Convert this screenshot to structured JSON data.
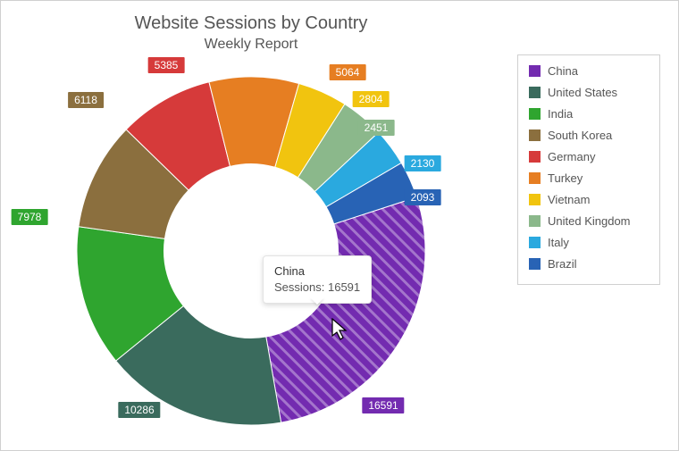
{
  "title": "Website Sessions by Country",
  "subtitle": "Weekly Report",
  "tooltip": {
    "title": "China",
    "metric_label": "Sessions",
    "value": "16591"
  },
  "legend": [
    {
      "label": "China",
      "color": "#732bb0"
    },
    {
      "label": "United States",
      "color": "#3a6b5d"
    },
    {
      "label": "India",
      "color": "#2fa52f"
    },
    {
      "label": "South Korea",
      "color": "#8b6f3e"
    },
    {
      "label": "Germany",
      "color": "#d63a3a"
    },
    {
      "label": "Turkey",
      "color": "#e67e22"
    },
    {
      "label": "Vietnam",
      "color": "#f1c40f"
    },
    {
      "label": "United Kingdom",
      "color": "#8bb88b"
    },
    {
      "label": "Italy",
      "color": "#2aa9df"
    },
    {
      "label": "Brazil",
      "color": "#2863b5"
    }
  ],
  "labels": {
    "china": "16591",
    "us": "10286",
    "india": "7978",
    "skorea": "6118",
    "germany": "5385",
    "turkey": "5064",
    "vietnam": "2804",
    "uk": "2451",
    "italy": "2130",
    "brazil": "2093"
  },
  "chart_data": {
    "type": "pie",
    "title": "Website Sessions by Country",
    "subtitle": "Weekly Report",
    "value_label": "Sessions",
    "series": [
      {
        "name": "China",
        "value": 16591,
        "color": "#732bb0",
        "selected": true
      },
      {
        "name": "United States",
        "value": 10286,
        "color": "#3a6b5d"
      },
      {
        "name": "India",
        "value": 7978,
        "color": "#2fa52f"
      },
      {
        "name": "South Korea",
        "value": 6118,
        "color": "#8b6f3e"
      },
      {
        "name": "Germany",
        "value": 5385,
        "color": "#d63a3a"
      },
      {
        "name": "Turkey",
        "value": 5064,
        "color": "#e67e22"
      },
      {
        "name": "Vietnam",
        "value": 2804,
        "color": "#f1c40f"
      },
      {
        "name": "United Kingdom",
        "value": 2451,
        "color": "#8bb88b"
      },
      {
        "name": "Italy",
        "value": 2130,
        "color": "#2aa9df"
      },
      {
        "name": "Brazil",
        "value": 2093,
        "color": "#2863b5"
      }
    ],
    "inner_radius_ratio": 0.5,
    "start_angle_deg": 72
  }
}
